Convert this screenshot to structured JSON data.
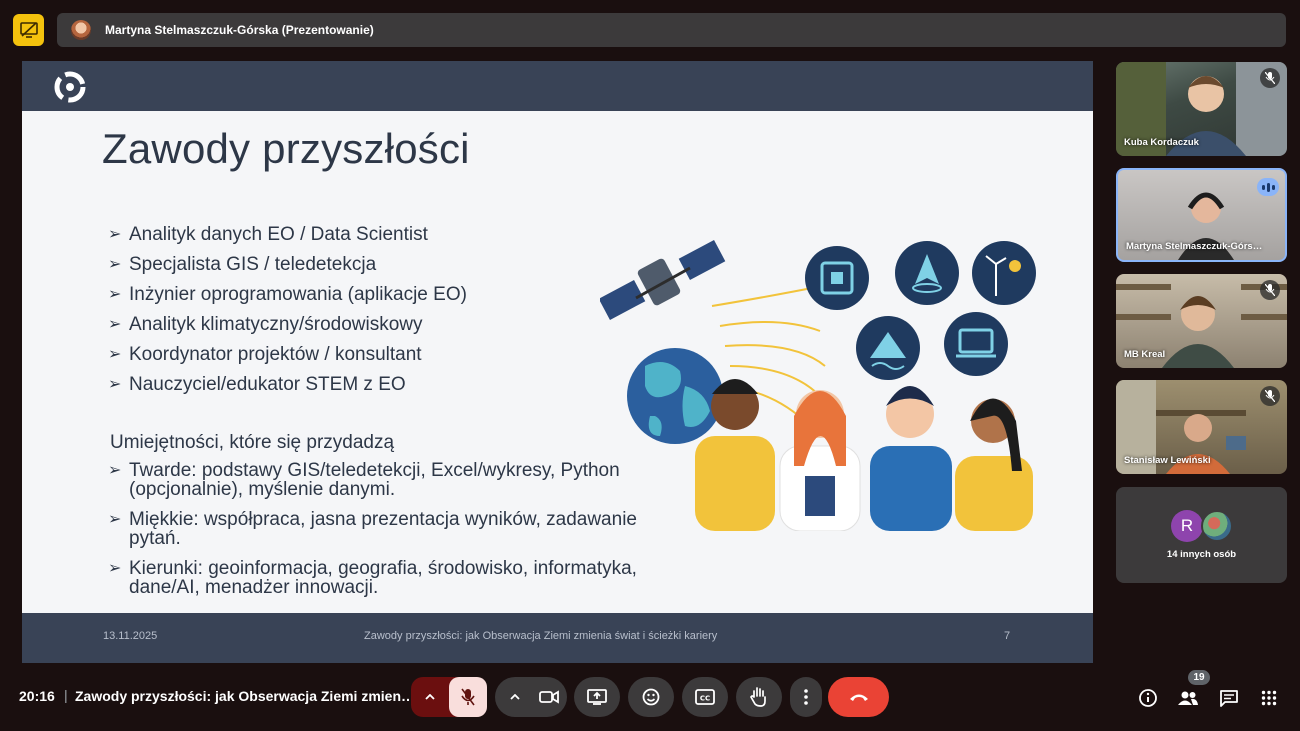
{
  "presenter_bar": {
    "name": "Martyna Stelmaszczuk-Górska (Prezentowanie)"
  },
  "slide": {
    "title": "Zawody przyszłości",
    "careers": [
      "Analityk danych EO / Data Scientist",
      "Specjalista GIS / teledetekcja",
      "Inżynier oprogramowania (aplikacje EO)",
      "Analityk klimatyczny/środowiskowy",
      "Koordynator projektów / konsultant",
      "Nauczyciel/edukator STEM z EO"
    ],
    "skills_heading": "Umiejętności, które się przydadzą",
    "skills": [
      "Twarde: podstawy GIS/teledetekcji, Excel/wykresy, Python (opcjonalnie), myślenie danymi.",
      "Miękkie: współpraca, jasna prezentacja wyników, zadawanie pytań.",
      "Kierunki: geoinformacja, geografia, środowisko, informatyka, dane/AI, menadżer innowacji."
    ],
    "bullet": "➢",
    "footer": {
      "date": "13.11.2025",
      "title": "Zawody przyszłości: jak Obserwacja Ziemi zmienia świat i ścieżki kariery",
      "page": "7"
    }
  },
  "participants": [
    {
      "name": "Kuba Kordaczuk",
      "muted": true
    },
    {
      "name": "Martyna Stelmaszczuk-Górs…",
      "speaking": true
    },
    {
      "name": "MB Kreal",
      "muted": true
    },
    {
      "name": "Stanisław Lewiński",
      "muted": true
    }
  ],
  "others": {
    "initial": "R",
    "label": "14 innych osób"
  },
  "bottom_bar": {
    "time": "20:16",
    "separator": "|",
    "meeting_title": "Zawody przyszłości: jak Obserwacja Ziemi zmien…",
    "participant_count": "19"
  },
  "colors": {
    "accent": "#8ab4f8",
    "end_call": "#ea4335",
    "present_badge": "#f4c20d",
    "slide_bar": "#394356"
  }
}
